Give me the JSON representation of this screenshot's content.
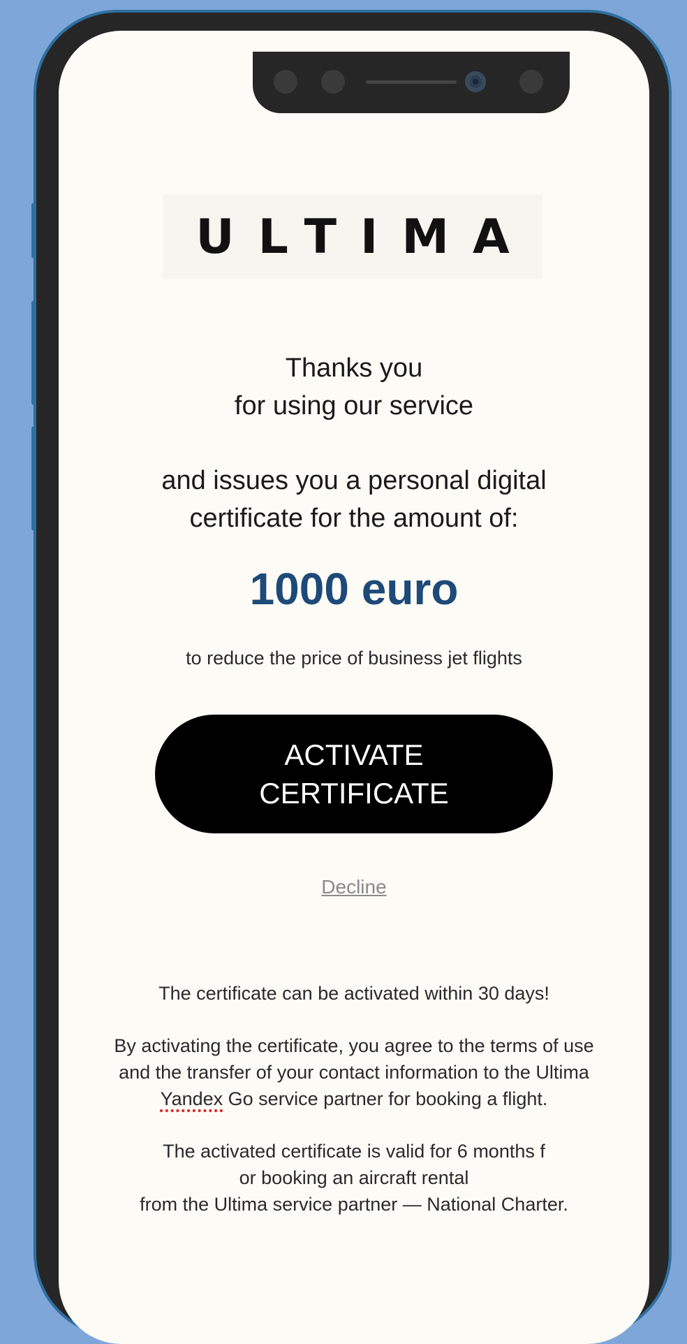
{
  "brand": {
    "logo_text": "ULTIMA"
  },
  "message": {
    "thanks_line1": "Thanks you",
    "thanks_line2": "for using our service",
    "issues_line1": "and issues you a personal digital",
    "issues_line2": "certificate for the amount of:",
    "amount": "1000 euro",
    "purpose": "to reduce the price of business jet flights"
  },
  "actions": {
    "activate_line1": "ACTIVATE",
    "activate_line2": "CERTIFICATE",
    "decline": "Decline"
  },
  "terms": {
    "activation_window": "The certificate can be activated within 30 days!",
    "agree_line1": "By activating the certificate, you agree to the terms of use",
    "agree_line2": "and the transfer of your contact information to the Ultima",
    "agree_line3_word": "Yandex",
    "agree_line3_rest": " Go service partner for booking a flight.",
    "valid_line1": "The activated certificate is valid for 6 months f",
    "valid_line2": "or booking an aircraft rental",
    "valid_line3": "from the Ultima service partner — National Charter."
  },
  "colors": {
    "background": "#7fa6d9",
    "phone_frame": "#262626",
    "screen": "#fdfbf6",
    "amount_accent": "#1d4a78",
    "button": "#000000"
  }
}
